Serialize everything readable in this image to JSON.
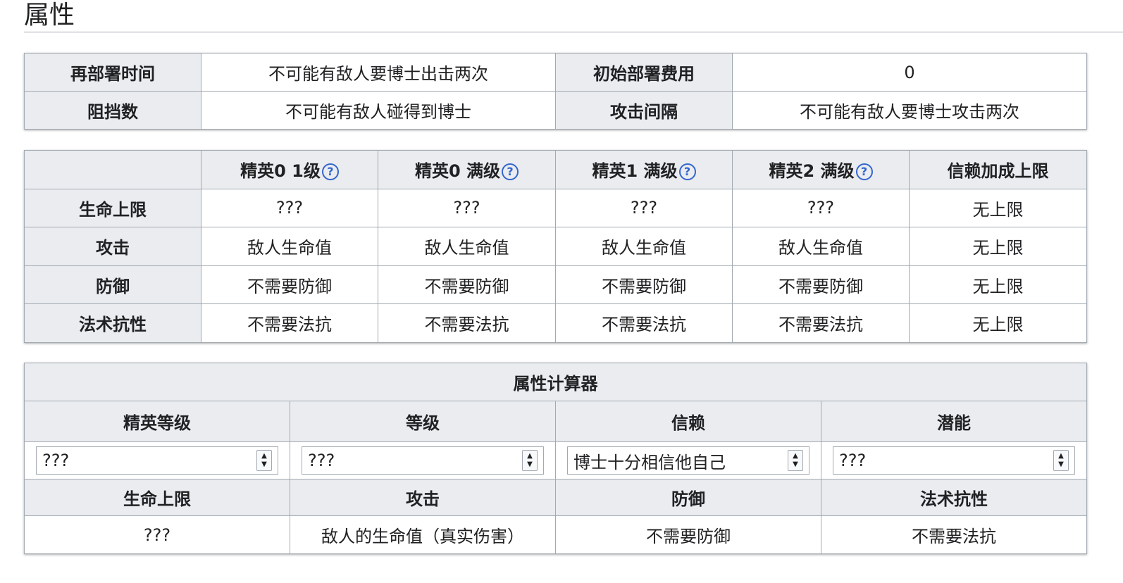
{
  "heading": "属性",
  "deploy": {
    "redeploy_label": "再部署时间",
    "redeploy_value": "不可能有敌人要博士出击两次",
    "cost_label": "初始部署费用",
    "cost_value": "0",
    "block_label": "阻挡数",
    "block_value": "不可能有敌人碰得到博士",
    "interval_label": "攻击间隔",
    "interval_value": "不可能有敌人要博士攻击两次"
  },
  "stats": {
    "headers": [
      "精英0 1级",
      "精英0 满级",
      "精英1 满级",
      "精英2 满级",
      "信赖加成上限"
    ],
    "help_icon": "?",
    "rows": [
      {
        "label": "生命上限",
        "values": [
          "???",
          "???",
          "???",
          "???",
          "无上限"
        ]
      },
      {
        "label": "攻击",
        "values": [
          "敌人生命值",
          "敌人生命值",
          "敌人生命值",
          "敌人生命值",
          "无上限"
        ]
      },
      {
        "label": "防御",
        "values": [
          "不需要防御",
          "不需要防御",
          "不需要防御",
          "不需要防御",
          "无上限"
        ]
      },
      {
        "label": "法术抗性",
        "values": [
          "不需要法抗",
          "不需要法抗",
          "不需要法抗",
          "不需要法抗",
          "无上限"
        ]
      }
    ]
  },
  "calculator": {
    "title": "属性计算器",
    "select_labels": [
      "精英等级",
      "等级",
      "信赖",
      "潜能"
    ],
    "select_values": [
      "???",
      "???",
      "博士十分相信他自己",
      "???"
    ],
    "result_labels": [
      "生命上限",
      "攻击",
      "防御",
      "法术抗性"
    ],
    "result_values": [
      "???",
      "敌人的生命值（真实伤害）",
      "不需要防御",
      "不需要法抗"
    ]
  }
}
